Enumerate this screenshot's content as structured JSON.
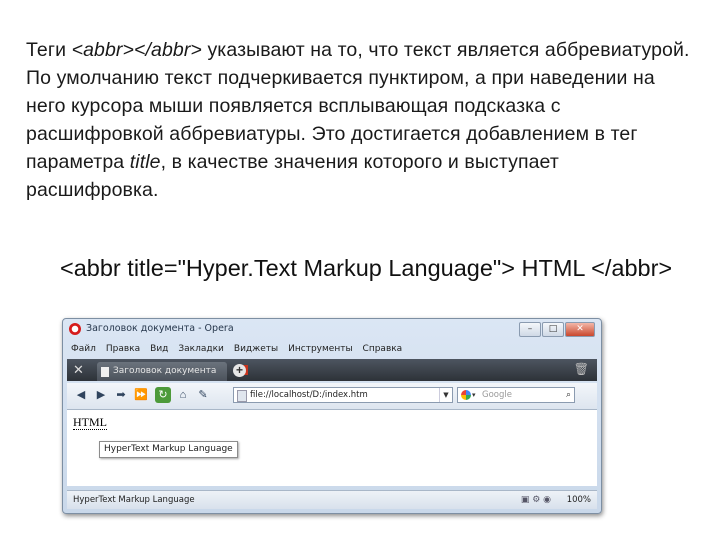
{
  "slide": {
    "text_part1": "Теги ",
    "tag_italic": "<abbr></abbr>",
    "text_part2": " указывают на то, что текст является аббревиатурой. По умолчанию текст подчеркивается пунктиром, а при наведении на него курсора мыши появляется всплывающая подсказка с расшифровкой аббревиатуры. Это достигается добавлением в тег параметра ",
    "param_italic": "title",
    "text_part3": ", в качестве значения которого и выступает расшифровка.",
    "code_example": "<abbr title=\"Hyper.Text Markup Language\"> HTML </abbr>"
  },
  "browser": {
    "title": "Заголовок документа - Opera",
    "window_buttons": {
      "minimize": "–",
      "maximize": "□",
      "close": "✕"
    },
    "menu": [
      "Файл",
      "Правка",
      "Вид",
      "Закладки",
      "Виджеты",
      "Инструменты",
      "Справка"
    ],
    "tab_title": "Заголовок документа",
    "tab_close": "x",
    "new_tab": "+",
    "address": "file://localhost/D:/index.htm",
    "search_placeholder": "Google",
    "page_abbr": "HTML",
    "tooltip": "HyperText Markup Language",
    "status_text": "HyperText Markup Language",
    "zoom": "100%"
  },
  "icons": {
    "back": "back-arrow-icon",
    "forward": "forward-arrow-icon",
    "fast_forward": "fast-forward-icon",
    "reload": "reload-icon",
    "home": "home-icon",
    "wand": "wand-icon",
    "search_go": "magnifier-icon"
  },
  "colors": {
    "opera_red": "#d61c1c",
    "tab_bar": "#2d3238",
    "window_frame": "#c9d8ea"
  }
}
